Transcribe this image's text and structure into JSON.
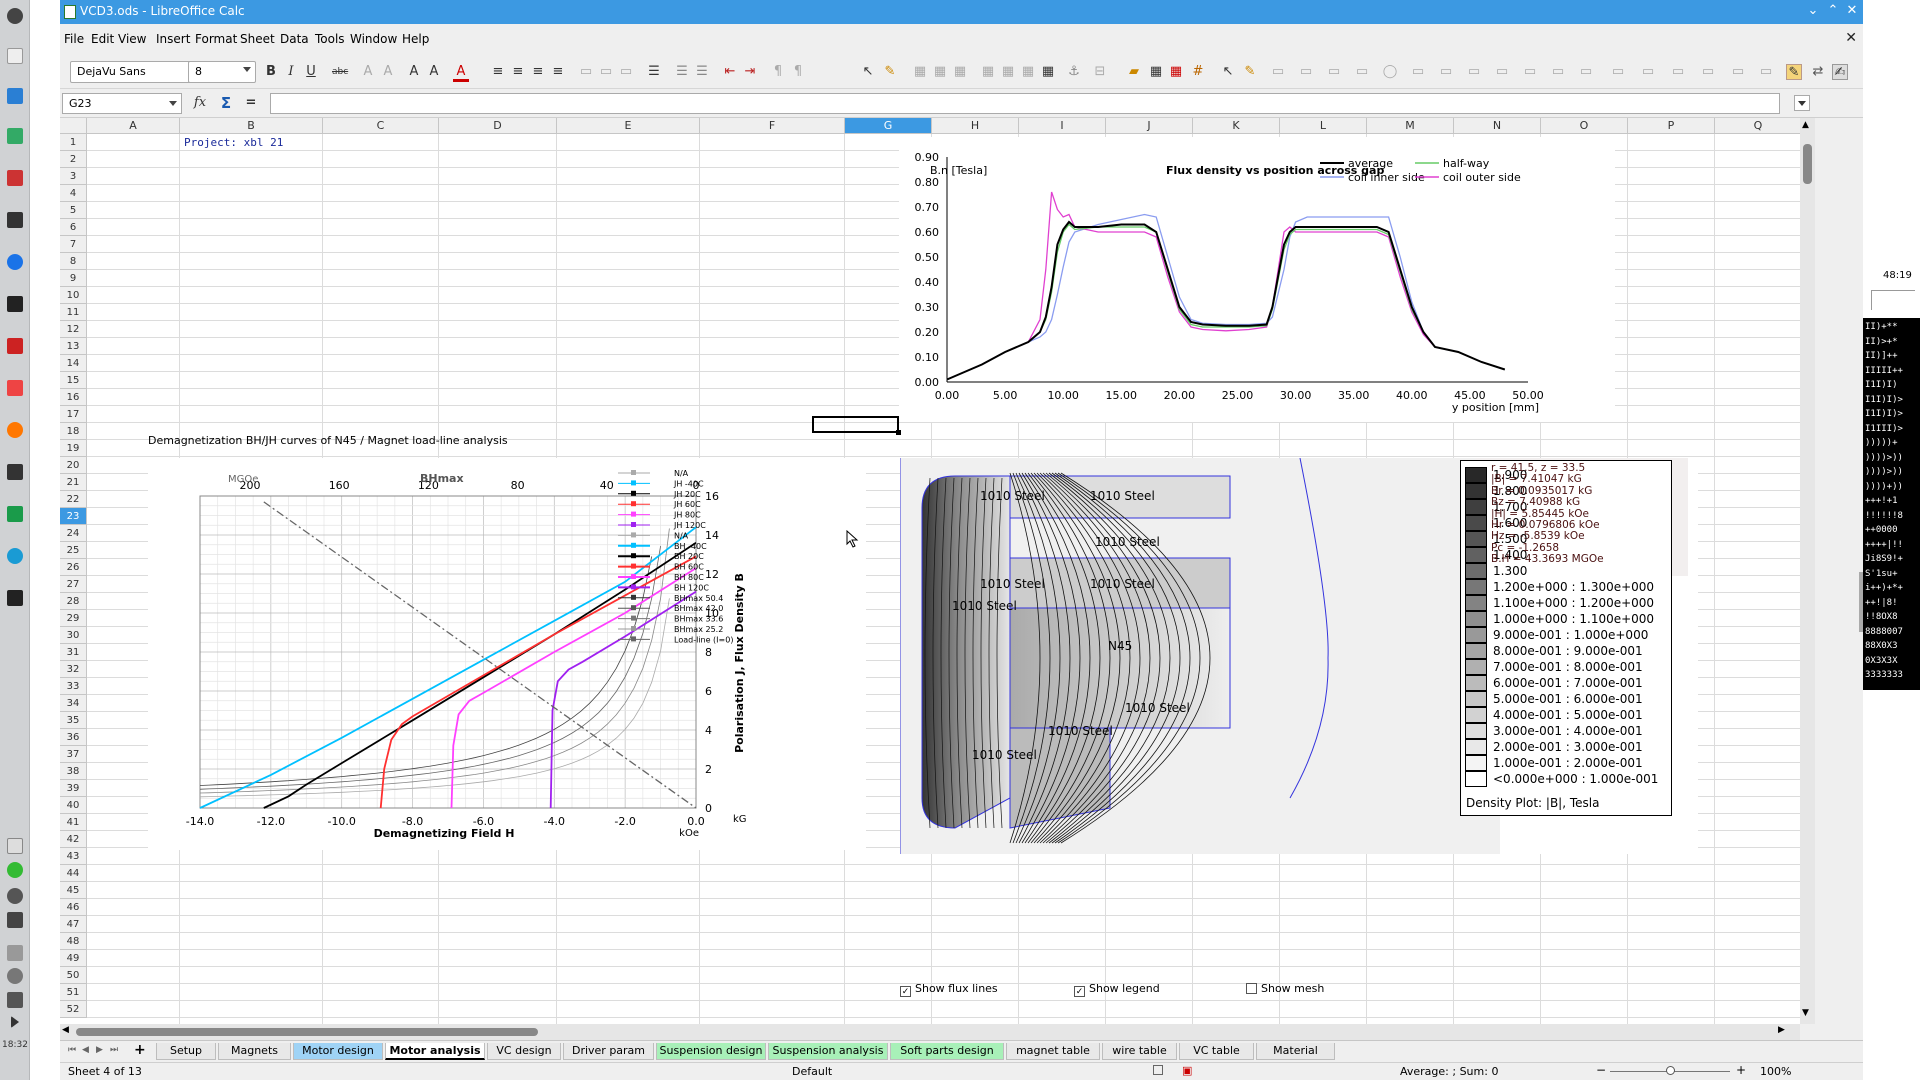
{
  "window": {
    "title": "VCD3.ods - LibreOffice Calc"
  },
  "menu": [
    "File",
    "Edit",
    "View",
    "Insert",
    "Format",
    "Sheet",
    "Data",
    "Tools",
    "Window",
    "Help"
  ],
  "toolbar": {
    "font_name": "DejaVu Sans",
    "font_size": "8"
  },
  "formula_bar": {
    "cell_ref": "G23",
    "content": ""
  },
  "columns": [
    "A",
    "B",
    "C",
    "D",
    "E",
    "F",
    "G",
    "H",
    "I",
    "J",
    "K",
    "L",
    "M",
    "N",
    "O",
    "P",
    "Q"
  ],
  "rows": [
    "1",
    "2",
    "3",
    "4",
    "5",
    "6",
    "7",
    "8",
    "9",
    "10",
    "11",
    "12",
    "13",
    "14",
    "15",
    "16",
    "17",
    "18",
    "19",
    "20",
    "21",
    "22",
    "23",
    "24",
    "25",
    "26",
    "27",
    "28",
    "29",
    "30",
    "31",
    "32",
    "33",
    "34",
    "35",
    "36",
    "37",
    "38",
    "39",
    "40",
    "41",
    "42",
    "43",
    "44",
    "45",
    "46",
    "47",
    "48",
    "49",
    "50",
    "51",
    "52"
  ],
  "cells": {
    "b1": "Project: xbl 21",
    "b24": "Demagnetization BH/JH curves of N45  /  Magnet load-line analysis"
  },
  "flux_chart": {
    "chart_data": {
      "type": "line",
      "title": "Flux density vs position across gap",
      "ylabel": "B.n  [Tesla]",
      "xlabel": "y position [mm]",
      "xlim": [
        0,
        50
      ],
      "ylim": [
        0,
        0.9
      ],
      "xticks": [
        "0.00",
        "5.00",
        "10.00",
        "15.00",
        "20.00",
        "25.00",
        "30.00",
        "35.00",
        "40.00",
        "45.00",
        "50.00"
      ],
      "yticks": [
        "0.00",
        "0.10",
        "0.20",
        "0.30",
        "0.40",
        "0.50",
        "0.60",
        "0.70",
        "0.80",
        "0.90"
      ],
      "legend": "top-right",
      "series": [
        {
          "name": "average",
          "color": "#000000",
          "x": [
            0,
            3,
            5,
            7,
            8,
            8.5,
            9,
            9.5,
            10,
            10.5,
            11,
            13,
            15,
            17,
            18,
            19,
            20,
            21,
            22,
            24,
            26,
            27.5,
            28,
            29,
            29.5,
            30,
            31,
            33,
            35,
            37,
            38,
            39,
            40,
            41,
            42,
            44,
            46,
            48
          ],
          "y": [
            0.01,
            0.07,
            0.12,
            0.16,
            0.2,
            0.26,
            0.38,
            0.55,
            0.61,
            0.64,
            0.62,
            0.62,
            0.63,
            0.63,
            0.6,
            0.45,
            0.3,
            0.24,
            0.23,
            0.225,
            0.225,
            0.23,
            0.3,
            0.55,
            0.6,
            0.62,
            0.62,
            0.62,
            0.62,
            0.62,
            0.6,
            0.45,
            0.3,
            0.2,
            0.14,
            0.12,
            0.08,
            0.05
          ]
        },
        {
          "name": "half-way",
          "color": "#66cc66",
          "x": [
            0,
            3,
            5,
            7,
            8,
            8.5,
            9,
            9.5,
            10,
            10.5,
            11,
            13,
            15,
            17,
            18,
            19,
            20,
            21,
            22,
            24,
            26,
            27.5,
            28,
            29,
            29.5,
            30,
            31,
            33,
            35,
            37,
            38,
            39,
            40,
            41,
            42,
            44,
            46,
            48
          ],
          "y": [
            0.01,
            0.07,
            0.12,
            0.16,
            0.2,
            0.25,
            0.36,
            0.52,
            0.6,
            0.63,
            0.61,
            0.62,
            0.62,
            0.62,
            0.6,
            0.44,
            0.29,
            0.23,
            0.22,
            0.22,
            0.22,
            0.225,
            0.29,
            0.53,
            0.59,
            0.61,
            0.61,
            0.61,
            0.61,
            0.61,
            0.59,
            0.44,
            0.29,
            0.2,
            0.14,
            0.12,
            0.08,
            0.05
          ]
        },
        {
          "name": "coil inner side",
          "color": "#8a9cf0",
          "x": [
            0,
            3,
            5,
            7,
            8,
            8.5,
            9,
            9.5,
            10,
            10.5,
            11,
            13,
            15,
            17,
            18,
            19,
            20,
            21,
            22,
            24,
            26,
            27.5,
            28,
            29,
            29.5,
            30,
            31,
            33,
            35,
            37,
            38,
            39,
            40,
            41,
            42,
            44,
            46,
            48
          ],
          "y": [
            0.01,
            0.07,
            0.12,
            0.16,
            0.18,
            0.2,
            0.25,
            0.35,
            0.46,
            0.56,
            0.6,
            0.63,
            0.65,
            0.67,
            0.66,
            0.5,
            0.34,
            0.25,
            0.235,
            0.23,
            0.23,
            0.235,
            0.26,
            0.45,
            0.58,
            0.64,
            0.66,
            0.66,
            0.66,
            0.66,
            0.66,
            0.5,
            0.32,
            0.2,
            0.14,
            0.12,
            0.08,
            0.05
          ]
        },
        {
          "name": "coil outer side",
          "color": "#e040d0",
          "x": [
            0,
            3,
            5,
            7,
            8,
            8.5,
            9,
            9.5,
            10,
            10.5,
            11,
            13,
            15,
            17,
            18,
            19,
            20,
            21,
            22,
            24,
            26,
            27.5,
            28,
            29,
            29.5,
            30,
            31,
            33,
            35,
            37,
            38,
            39,
            40,
            41,
            42,
            44,
            46,
            48
          ],
          "y": [
            0.01,
            0.07,
            0.12,
            0.16,
            0.25,
            0.45,
            0.76,
            0.69,
            0.66,
            0.67,
            0.62,
            0.6,
            0.6,
            0.6,
            0.58,
            0.42,
            0.28,
            0.22,
            0.21,
            0.205,
            0.21,
            0.22,
            0.3,
            0.6,
            0.62,
            0.6,
            0.6,
            0.6,
            0.6,
            0.6,
            0.58,
            0.42,
            0.28,
            0.19,
            0.14,
            0.12,
            0.08,
            0.05
          ]
        }
      ]
    }
  },
  "demag_chart": {
    "chart_data": {
      "type": "line",
      "xlabel": "Demagnetizing Field H",
      "ylabel": "Polarisation J,  Flux Density B",
      "top_label": "BHmax",
      "top_unit": "MGOe",
      "x_unit": "kOe",
      "y_unit": "kG",
      "xlim": [
        -14,
        0
      ],
      "ylim": [
        0,
        16
      ],
      "xticks": [
        "-14.0",
        "-12.0",
        "-10.0",
        "-8.0",
        "-6.0",
        "-4.0",
        "-2.0",
        "0.0"
      ],
      "yticks": [
        "0",
        "2",
        "4",
        "6",
        "8",
        "10",
        "12",
        "14",
        "16"
      ],
      "top_ticks": [
        "200",
        "160",
        "120",
        "80",
        "40",
        "0"
      ],
      "legend": "right",
      "legend_entries": [
        {
          "label": "N/A",
          "color": "#aaaaaa"
        },
        {
          "label": "JH -40C",
          "color": "#00c0ff"
        },
        {
          "label": "JH 20C",
          "color": "#000000"
        },
        {
          "label": "JH 60C",
          "color": "#ff3030"
        },
        {
          "label": "JH 80C",
          "color": "#ff40ff"
        },
        {
          "label": "JH 120C",
          "color": "#a020f0"
        },
        {
          "label": "N/A",
          "color": "#aaaaaa"
        },
        {
          "label": "BH -40C",
          "color": "#00c0ff"
        },
        {
          "label": "BH 20C",
          "color": "#000000"
        },
        {
          "label": "BH 60C",
          "color": "#ff3030"
        },
        {
          "label": "BH 80C",
          "color": "#ff40ff"
        },
        {
          "label": "BH 120C",
          "color": "#a020f0"
        },
        {
          "label": "BHmax 50.4",
          "color": "#333333"
        },
        {
          "label": "BHmax 42.0",
          "color": "#555555"
        },
        {
          "label": "BHmax 33.6",
          "color": "#777777"
        },
        {
          "label": "BHmax 25.2",
          "color": "#999999"
        },
        {
          "label": "Load-line (I=0)",
          "color": "#666666"
        }
      ],
      "series": [
        {
          "name": "BH -40C",
          "color": "#00c0ff",
          "x": [
            -14,
            -12,
            -10,
            -8,
            -6,
            -4,
            -2,
            0
          ],
          "y": [
            0,
            1.7,
            3.6,
            5.6,
            7.6,
            9.6,
            11.6,
            14.4
          ]
        },
        {
          "name": "BH 20C",
          "color": "#000000",
          "x": [
            -12.2,
            -11.5,
            -11,
            -10,
            -8,
            -6,
            -4,
            -2,
            0
          ],
          "y": [
            0,
            0.6,
            1.2,
            2.3,
            4.5,
            6.7,
            8.9,
            11.2,
            13.6
          ]
        },
        {
          "name": "BH 60C",
          "color": "#ff3030",
          "x": [
            -8.9,
            -8.8,
            -8.6,
            -8.3,
            -8,
            -6,
            -4,
            -2,
            0
          ],
          "y": [
            0,
            2,
            3.5,
            4.3,
            4.7,
            6.8,
            8.9,
            10.9,
            12.9
          ]
        },
        {
          "name": "BH 80C",
          "color": "#ff40ff",
          "x": [
            -6.9,
            -6.85,
            -6.7,
            -6.4,
            -6,
            -4,
            -2,
            0
          ],
          "y": [
            0,
            3.2,
            4.8,
            5.5,
            5.9,
            8,
            10,
            12.3
          ]
        },
        {
          "name": "BH 120C",
          "color": "#a020f0",
          "x": [
            -4.1,
            -4.05,
            -3.9,
            -3.6,
            -3.2,
            -2,
            0
          ],
          "y": [
            0,
            5,
            6.5,
            7.1,
            7.5,
            8.8,
            11.1
          ]
        },
        {
          "name": "Load-line (I=0)",
          "color": "#666666",
          "x": [
            -12.2,
            0
          ],
          "y": [
            15.7,
            0
          ]
        }
      ]
    }
  },
  "fem_plot": {
    "region_labels": [
      "1010 Steel",
      "1010 Steel",
      "1010 Steel",
      "1010 Steel",
      "1010 Steel",
      "1010 Steel",
      "N45",
      "1010 Steel",
      "1010 Steel",
      "1010 Steel"
    ],
    "info": [
      "r = 41.5, z = 33.5",
      "|B| = 7.41047 kG",
      "Br = 0.0935017 kG",
      "Bz = 7.40988 kG",
      "|H| = 5.85445 kOe",
      "Hr = 0.0796806 kOe",
      "Hz = -5.8539 kOe",
      "Pc = -1.2658",
      "B.H = 43.3693 MGOe"
    ],
    "legend_short": [
      "1.900",
      "1.800",
      "1.700",
      "1.600",
      "1.500",
      "1.400",
      "1.300"
    ],
    "legend_long": [
      "1.200e+000 : 1.300e+000",
      "1.100e+000 : 1.200e+000",
      "1.000e+000 : 1.100e+000",
      "9.000e-001 : 1.000e+000",
      "8.000e-001 : 9.000e-001",
      "7.000e-001 : 8.000e-001",
      "6.000e-001 : 7.000e-001",
      "5.000e-001 : 6.000e-001",
      "4.000e-001 : 5.000e-001",
      "3.000e-001 : 4.000e-001",
      "2.000e-001 : 3.000e-001",
      "1.000e-001 : 2.000e-001",
      "<0.000e+000 : 1.000e-001"
    ],
    "legend_title": "Density Plot: |B|, Tesla",
    "checkboxes": [
      {
        "label": "Show flux lines",
        "checked": true
      },
      {
        "label": "Show legend",
        "checked": true
      },
      {
        "label": "Show mesh",
        "checked": false
      }
    ]
  },
  "sheet_tabs": [
    {
      "label": "Setup",
      "color": "#e8e8e8"
    },
    {
      "label": "Magnets",
      "color": "#e8e8e8"
    },
    {
      "label": "Motor design",
      "color": "#9fd3f5"
    },
    {
      "label": "Motor analysis",
      "color": "#ffffff",
      "active": true
    },
    {
      "label": "VC design",
      "color": "#e8e8e8"
    },
    {
      "label": "Driver param",
      "color": "#e8e8e8"
    },
    {
      "label": "Suspension design",
      "color": "#a8f0b8"
    },
    {
      "label": "Suspension analysis",
      "color": "#a8f0b8"
    },
    {
      "label": "Soft parts design",
      "color": "#a8f0b8"
    },
    {
      "label": "magnet table",
      "color": "#e8e8e8"
    },
    {
      "label": "wire table",
      "color": "#e8e8e8"
    },
    {
      "label": "VC table",
      "color": "#e8e8e8"
    },
    {
      "label": "Material",
      "color": "#e8e8e8"
    }
  ],
  "status": {
    "sheet": "Sheet 4 of 13",
    "style": "Default",
    "sum": "Average: ; Sum: 0",
    "zoom": "100%"
  },
  "dock": {
    "time": "18:32"
  },
  "terminal": {
    "time": "48:19",
    "lines": [
      "II)+**",
      "II)>+*",
      "II)]++",
      "IIIII++",
      "I1I)I)",
      "I1I)I)>",
      "I1I)I)>",
      "I1III)>",
      ")))))+",
      "))))>))",
      "))))>))",
      "))))+))",
      "+++!+1",
      "!!!!!!8",
      "++0000",
      "++++|!!",
      "Ji8S9!+",
      "S'1su+",
      "i++)+*+",
      "++!|8!",
      "!!8OX8",
      "8888007",
      "88X0X3",
      "0X3X3X",
      "3333333"
    ]
  }
}
